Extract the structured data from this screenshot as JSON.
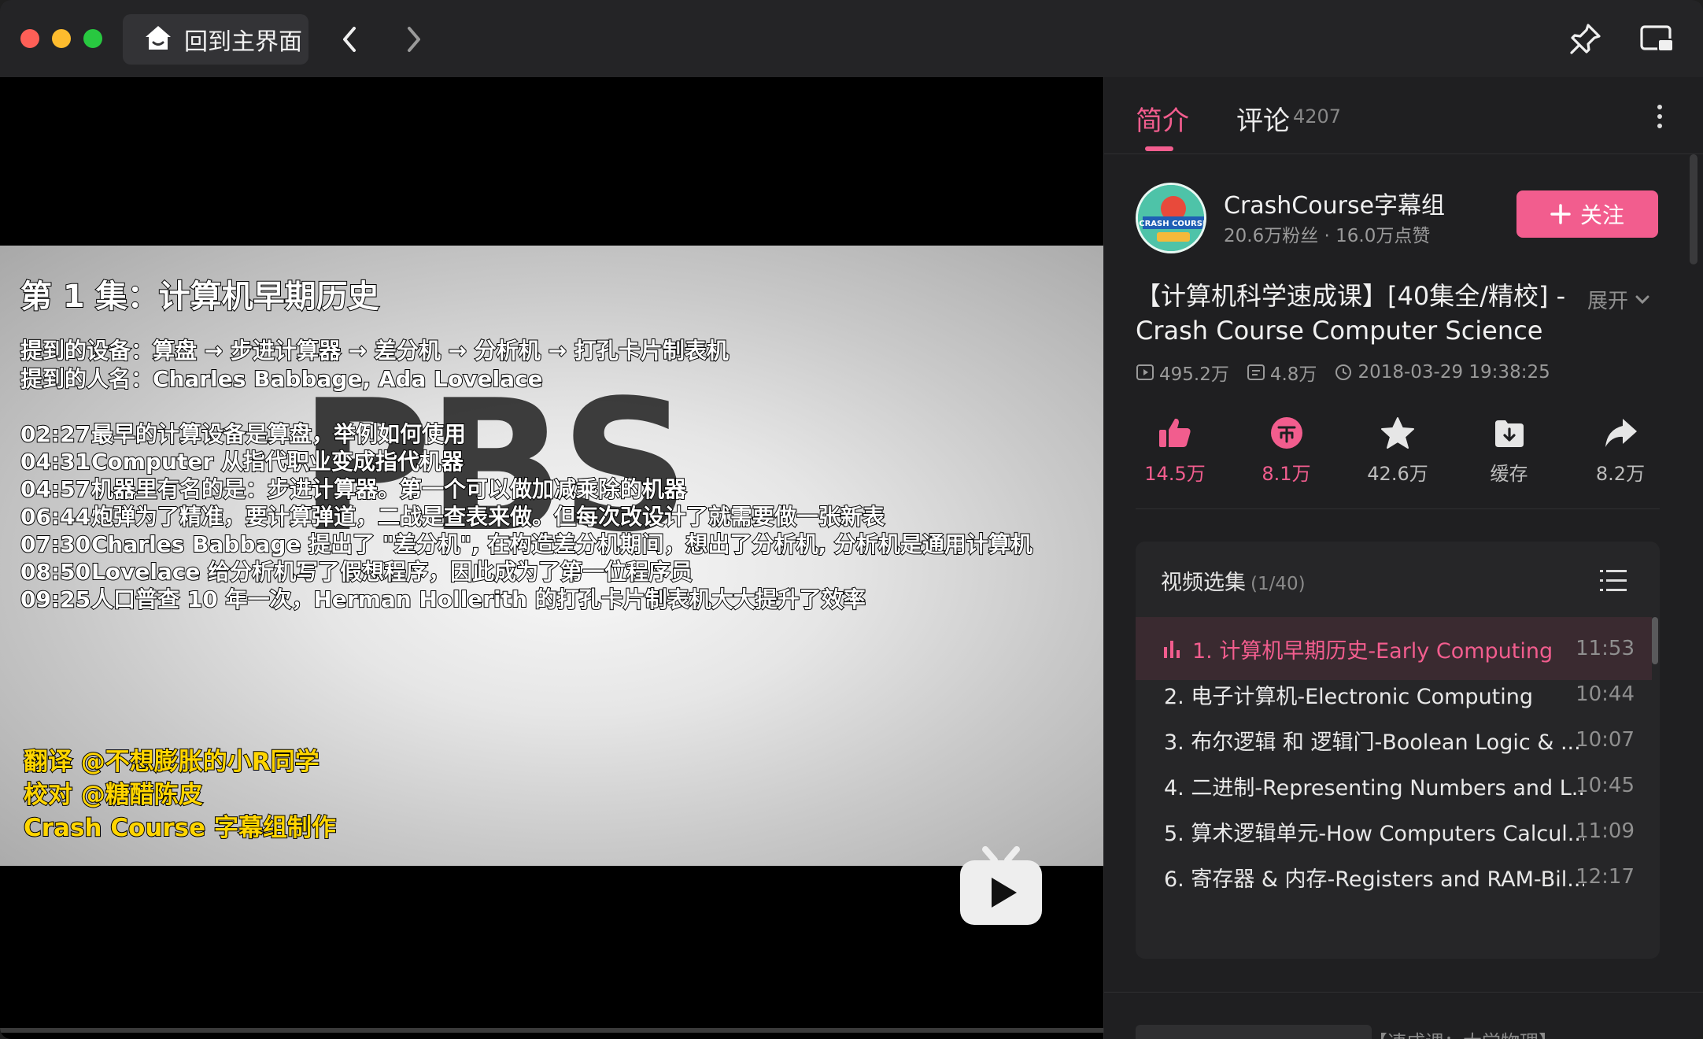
{
  "titlebar": {
    "home_label": "回到主界面",
    "icons": [
      "home-icon",
      "chevron-left-icon",
      "chevron-right-icon",
      "pin-icon",
      "picture-in-picture-icon"
    ]
  },
  "video": {
    "overlay_title": "第 1 集：计算机早期历史",
    "devices_line": "提到的设备：算盘 → 步进计算器 → 差分机 → 分析机 → 打孔卡片制表机",
    "people_line": "提到的人名：Charles Babbage, Ada Lovelace",
    "chapters": [
      {
        "time": "02:27",
        "text": "最早的计算设备是算盘，举例如何使用"
      },
      {
        "time": "04:31",
        "text": "Computer 从指代职业变成指代机器"
      },
      {
        "time": "04:57",
        "text": "机器里有名的是：步进计算器。第一个可以做加减乘除的机器"
      },
      {
        "time": "06:44",
        "text": "炮弹为了精准，要计算弹道，二战是查表来做。但每次改设计了就需要做一张新表"
      },
      {
        "time": "07:30",
        "text": "Charles Babbage 提出了 \"差分机\", 在构造差分机期间，想出了分析机, 分析机是通用计算机"
      },
      {
        "time": "08:50",
        "text": "Lovelace 给分析机写了假想程序，因此成为了第一位程序员"
      },
      {
        "time": "09:25",
        "text": "人口普查 10 年一次，Herman Hollerith 的打孔卡片制表机大大提升了效率"
      }
    ],
    "credits": [
      "翻译 @不想膨胀的小R同学",
      "校对 @糖醋陈皮",
      "Crash Course 字幕组制作"
    ],
    "bg_logo": "PBS"
  },
  "panel": {
    "tab_intro": "简介",
    "tab_comments": "评论",
    "comment_count": "4207",
    "uploader": {
      "name": "CrashCourse字幕组",
      "stats": "20.6万粉丝 · 16.0万点赞",
      "avatar_text": "CRASH COURSE"
    },
    "follow_label": "关注",
    "video_title": "【计算机科学速成课】[40集全/精校] - Crash Course Computer Science",
    "expand_label": "展开",
    "meta": {
      "views": "495.2万",
      "danmaku": "4.8万",
      "date": "2018-03-29 19:38:25"
    },
    "actions": [
      {
        "name": "like",
        "icon": "thumbs-up-icon",
        "count": "14.5万"
      },
      {
        "name": "coin",
        "icon": "coin-icon",
        "count": "8.1万"
      },
      {
        "name": "favorite",
        "icon": "star-icon",
        "count": "42.6万"
      },
      {
        "name": "cache",
        "icon": "download-icon",
        "count": "缓存"
      },
      {
        "name": "share",
        "icon": "share-icon",
        "count": "8.2万"
      }
    ],
    "playlist": {
      "title": "视频选集",
      "progress": "(1/40)",
      "items": [
        {
          "title": "1. 计算机早期历史-Early Computing",
          "duration": "11:53"
        },
        {
          "title": "2. 电子计算机-Electronic Computing",
          "duration": "10:44"
        },
        {
          "title": "3. 布尔逻辑 和 逻辑门-Boolean Logic & ...",
          "duration": "10:07"
        },
        {
          "title": "4. 二进制-Representing Numbers and L...",
          "duration": "10:45"
        },
        {
          "title": "5. 算术逻辑单元-How Computers Calcul...",
          "duration": "11:09"
        },
        {
          "title": "6. 寄存器 & 内存-Registers and RAM-Bil...",
          "duration": "12:17"
        }
      ]
    },
    "peek_text": "【速成课：大学物理】"
  },
  "colors": {
    "accent": "#f25d8e",
    "window_bg": "#1c1c1e",
    "subtitle_yellow": "#ffd500"
  }
}
